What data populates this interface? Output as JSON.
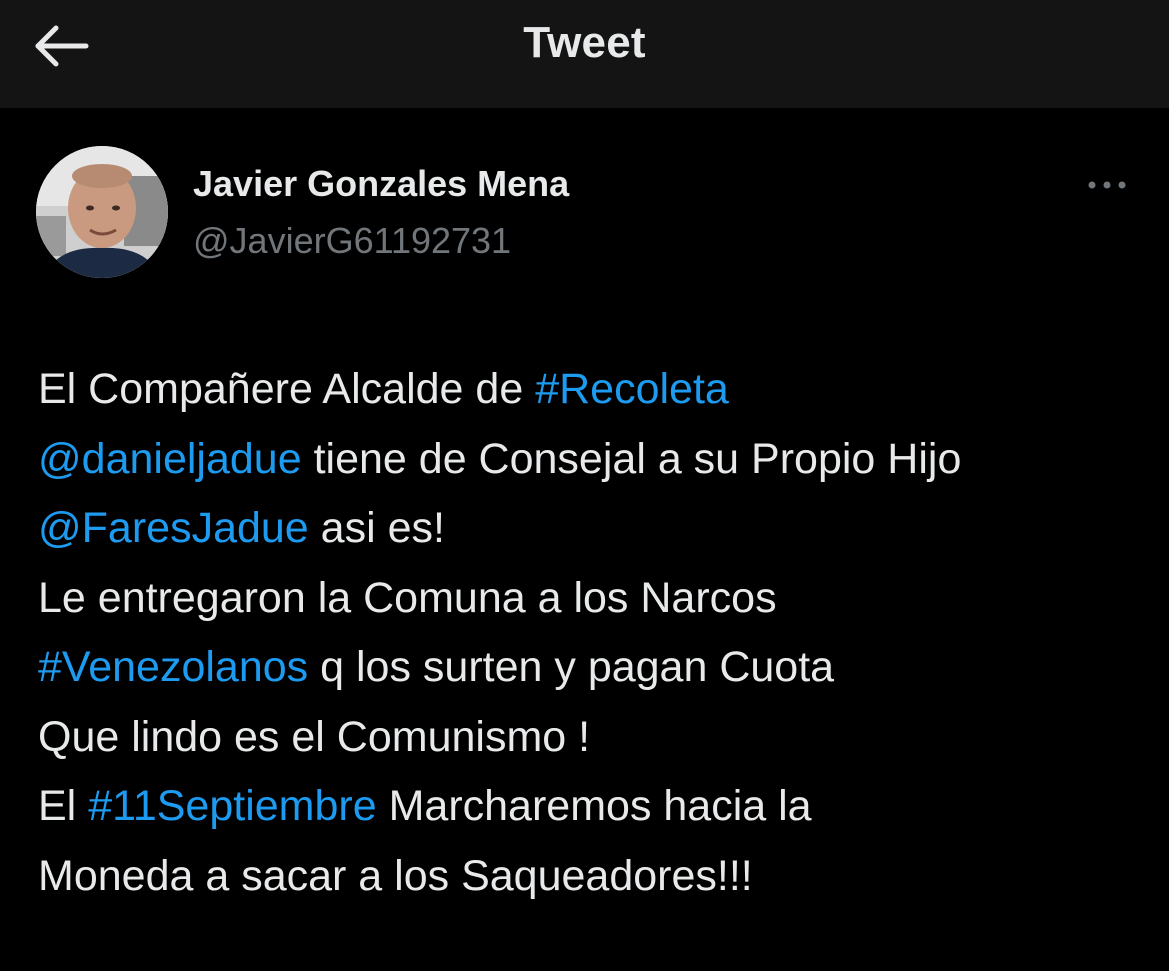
{
  "header": {
    "title": "Tweet",
    "back_icon": "arrow-left-icon"
  },
  "author": {
    "name": "Javier Gonzales Mena",
    "handle": "@JavierG61192731",
    "avatar_icon": "avatar-photo"
  },
  "more_icon": "more-horizontal-icon",
  "colors": {
    "background": "#000000",
    "header_bg": "#141414",
    "text": "#e7e9ea",
    "secondary_text": "#71767b",
    "link": "#1d9bf0"
  },
  "tweet": {
    "lines": [
      [
        {
          "text": "El Compañere Alcalde de ",
          "link": false
        },
        {
          "text": "#Recoleta",
          "link": true
        }
      ],
      [
        {
          "text": "@danieljadue",
          "link": true
        },
        {
          "text": " tiene de Consejal a su Propio Hijo",
          "link": false
        }
      ],
      [
        {
          "text": "@FaresJadue",
          "link": true
        },
        {
          "text": " asi es!",
          "link": false
        }
      ],
      [
        {
          "text": "Le entregaron la Comuna a los Narcos",
          "link": false
        }
      ],
      [
        {
          "text": "#Venezolanos",
          "link": true
        },
        {
          "text": " q los surten y pagan Cuota",
          "link": false
        }
      ],
      [
        {
          "text": "Que lindo es el Comunismo !",
          "link": false
        }
      ],
      [
        {
          "text": "El ",
          "link": false
        },
        {
          "text": "#11Septiembre",
          "link": true
        },
        {
          "text": " Marcharemos hacia la",
          "link": false
        }
      ],
      [
        {
          "text": "Moneda a sacar a los Saqueadores!!!",
          "link": false
        }
      ]
    ]
  }
}
